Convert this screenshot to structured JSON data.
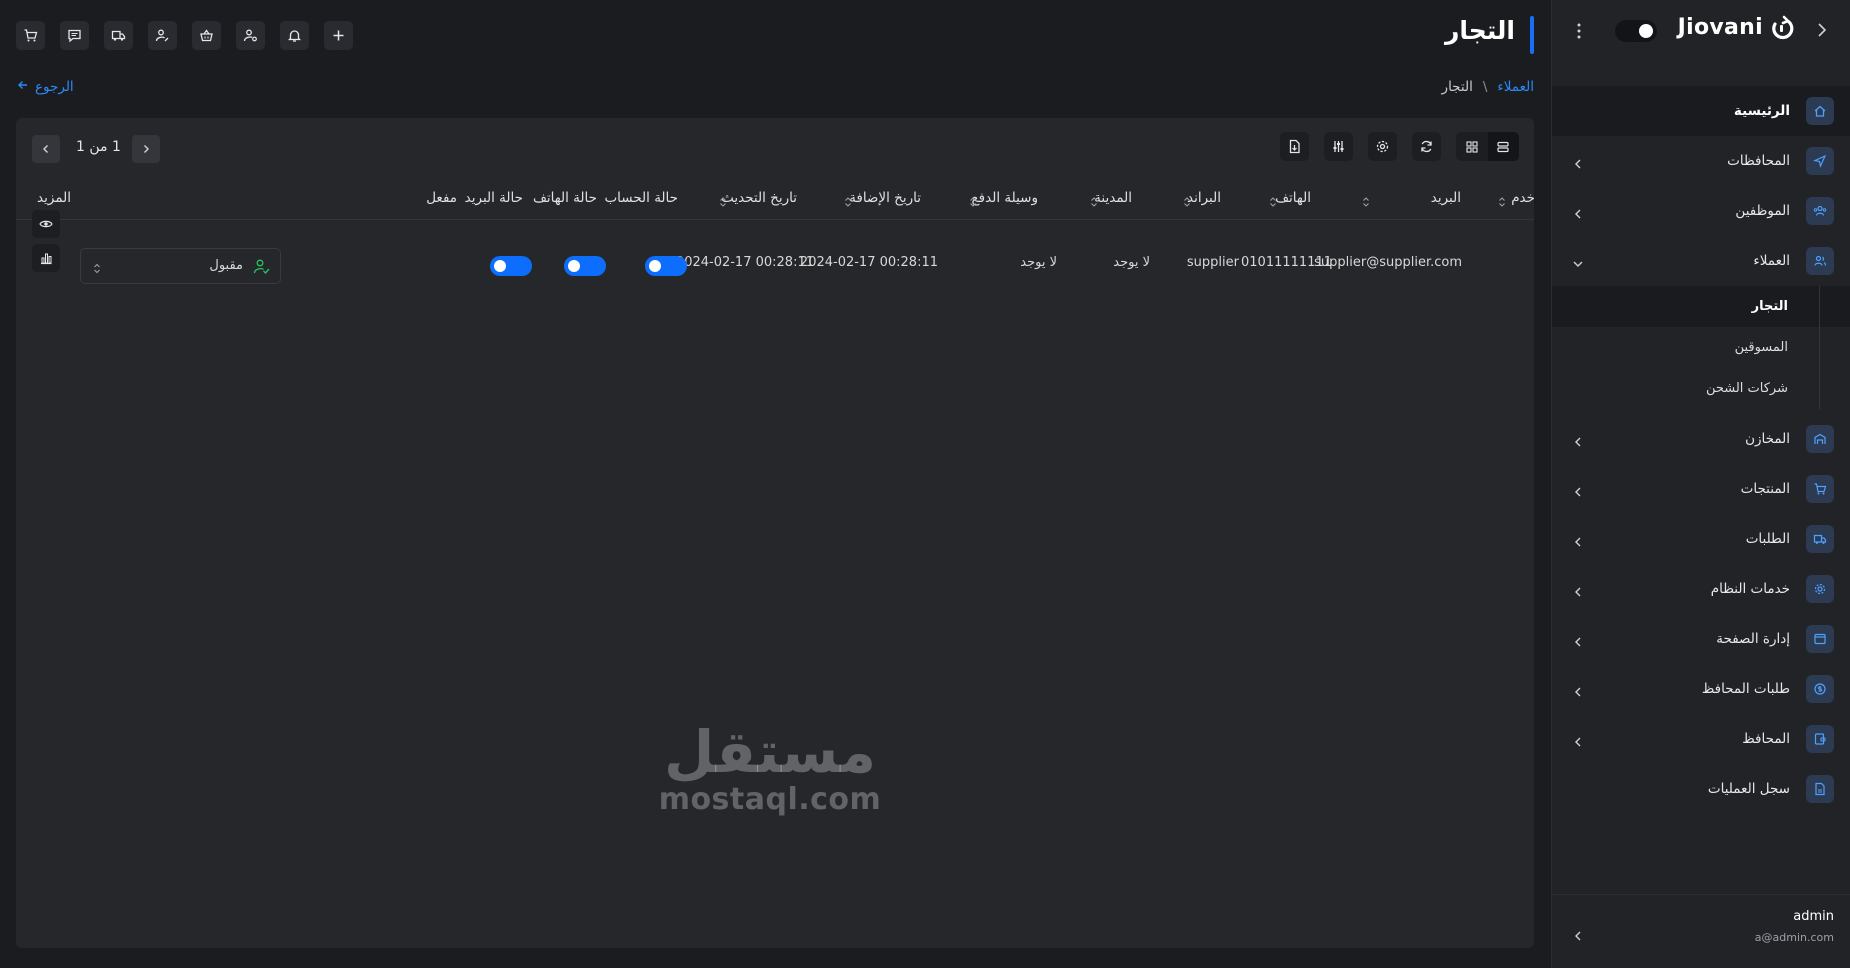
{
  "app": {
    "brand": "Jiovani"
  },
  "page": {
    "title": "التجار"
  },
  "breadcrumb": {
    "parent": "العملاء",
    "separator": "\\",
    "current": "التجار"
  },
  "back": {
    "label": "الرجوع"
  },
  "sidebar": {
    "items": [
      {
        "label": "الرئيسية",
        "icon": "home-icon",
        "active": true
      },
      {
        "label": "المحافظات",
        "icon": "send-icon"
      },
      {
        "label": "الموظفين",
        "icon": "team-icon"
      },
      {
        "label": "العملاء",
        "icon": "users-icon",
        "expanded": true,
        "children": [
          {
            "label": "التجار",
            "active": true
          },
          {
            "label": "المسوقين"
          },
          {
            "label": "شركات الشحن"
          }
        ]
      },
      {
        "label": "المخازن",
        "icon": "warehouse-icon"
      },
      {
        "label": "المنتجات",
        "icon": "cart-icon"
      },
      {
        "label": "الطلبات",
        "icon": "truck-icon"
      },
      {
        "label": "خدمات النظام",
        "icon": "gear-icon"
      },
      {
        "label": "إدارة الصفحة",
        "icon": "window-icon"
      },
      {
        "label": "طلبات المحافظ",
        "icon": "dollar-icon"
      },
      {
        "label": "المحافظ",
        "icon": "wallet-icon"
      },
      {
        "label": "سجل العمليات",
        "icon": "file-icon"
      }
    ],
    "user": {
      "name": "admin",
      "email": "a@admin.com"
    }
  },
  "pager": {
    "text": "1 من 1"
  },
  "table": {
    "headers": {
      "service": "خدم",
      "email": "البريد",
      "phone": "الهاتف",
      "brand": "البراند",
      "city": "المدينة",
      "payment": "وسيلة الدفع",
      "created": "تاريخ الإضافة",
      "updated": "تاريخ التحديث",
      "account_status": "حالة الحساب",
      "phone_status": "حالة الهاتف",
      "email_status": "حالة البريد",
      "enabled": "مفعل",
      "more": "المزيد"
    },
    "rows": [
      {
        "email": "supplier@supplier.com",
        "phone": "01011111111",
        "brand": "supplier",
        "city": "لا يوجد",
        "payment": "لا يوجد",
        "created": "2024-02-17 00:28:11",
        "updated": "2024-02-17 00:28:11",
        "account_status": true,
        "phone_status": true,
        "email_status": true,
        "status": "مقبول"
      }
    ]
  },
  "watermark": {
    "ar": "مستقل",
    "en": "mostaql.com"
  },
  "colors": {
    "accent": "#1a6ef5",
    "link": "#2b8af7",
    "success": "#22c55e",
    "bg": "#1b1c20",
    "card": "#26272b"
  }
}
